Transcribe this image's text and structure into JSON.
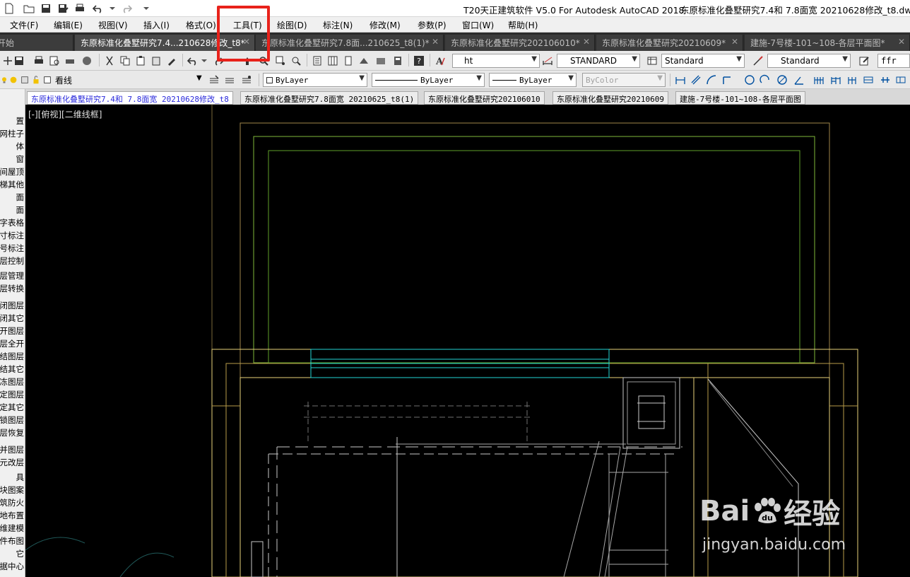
{
  "titlebar": {
    "app_title": "T20天正建筑软件 V5.0 For Autodesk AutoCAD 2018",
    "doc_title": "东原标准化叠墅研究7.4和 7.8面宽 20210628修改_t8.dwg"
  },
  "menu": [
    "文件(F)",
    "编辑(E)",
    "视图(V)",
    "插入(I)",
    "格式(O)",
    "工具(T)",
    "绘图(D)",
    "标注(N)",
    "修改(M)",
    "参数(P)",
    "窗口(W)",
    "帮助(H)"
  ],
  "doc_tabs": [
    {
      "label": "开始",
      "active": false
    },
    {
      "label": "东原标准化叠墅研究7.4...210628修改_t8*",
      "active": true
    },
    {
      "label": "东原标准化叠墅研究7.8面...210625_t8(1)*",
      "active": false
    },
    {
      "label": "东原标准化叠墅研究202106010*",
      "active": false
    },
    {
      "label": "东原标准化叠墅研究20210609*",
      "active": false
    },
    {
      "label": "建施-7号楼-101~108-各层平面图*",
      "active": false
    }
  ],
  "toolbar1": {
    "text_style": "ht",
    "dim_style": "STANDARD",
    "table_style": "Standard",
    "mleader_style": "Standard",
    "command_field": "ffr"
  },
  "toolbar2": {
    "layer": "看线",
    "color": "ByLayer",
    "linetype": "ByLayer",
    "lineweight": "ByLayer",
    "plotstyle": "ByColor"
  },
  "left_panel": [
    "置",
    "网柱子",
    "体",
    "窗",
    "间屋顶",
    "梯其他",
    "面",
    "面",
    "字表格",
    "寸标注",
    "号标注",
    "层控制",
    "层管理",
    "层转换",
    "闭图层",
    "闭其它",
    "开图层",
    "层全开",
    "结图层",
    "结其它",
    "冻图层",
    "定图层",
    "定其它",
    "锁图层",
    "层恢复",
    "并图层",
    "元改层",
    "具",
    "块图案",
    "筑防火",
    "地布置",
    "维建模",
    "件布图",
    "它",
    "据中心"
  ],
  "drawing_tabs": [
    {
      "label": "东原标准化叠墅研究7.4和 7.8面宽 20210628修改_t8",
      "active": true
    },
    {
      "label": "东原标准化叠墅研究7.8面宽 20210625_t8(1)",
      "active": false
    },
    {
      "label": "东原标准化叠墅研究202106010",
      "active": false
    },
    {
      "label": "东原标准化叠墅研究20210609",
      "active": false
    },
    {
      "label": "建施-7号楼-101~108-各层平面图",
      "active": false
    }
  ],
  "viewport_label": "[-][俯视][二维线框]",
  "watermark": {
    "logo_left": "Bai",
    "logo_right": "经验",
    "url": "jingyan.baidu.com"
  },
  "colors": {
    "highlight": "#e8221b",
    "cad_yellow": "#e8d27a",
    "cad_green": "#8ec94a",
    "cad_cyan": "#22d3d3",
    "cad_white": "#d0d0d0"
  }
}
